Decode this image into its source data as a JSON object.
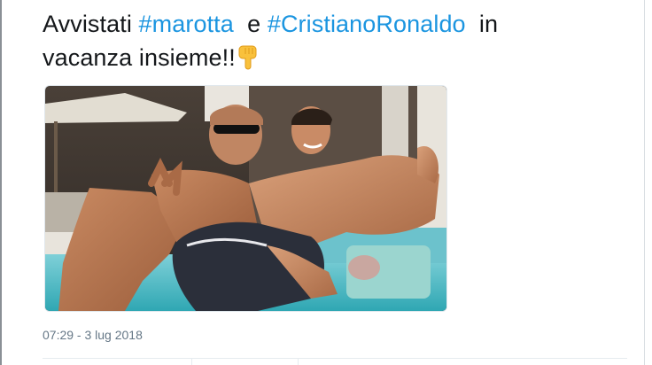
{
  "tweet": {
    "text_prefix": "Avvistati",
    "hashtag_1": "#marotta",
    "text_middle": "e",
    "hashtag_2": "#CristianoRonaldo",
    "text_line_end": "in",
    "text_line_2": "vacanza insieme!!",
    "emoji": "pointing-down-hand-emoji",
    "timestamp": "07:29 - 3 lug 2018"
  },
  "colors": {
    "hashtag": "#1b95e0",
    "text": "#14171a",
    "meta": "#657786"
  }
}
